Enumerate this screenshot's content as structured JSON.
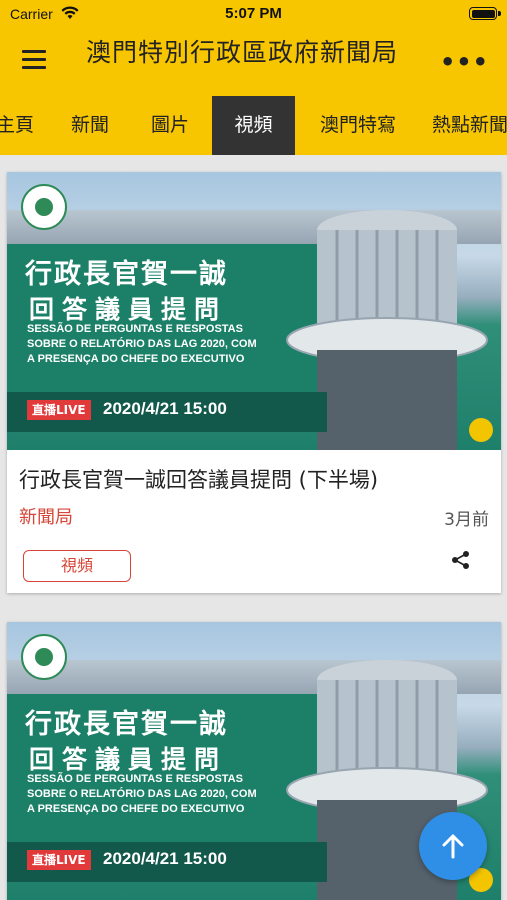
{
  "status_bar": {
    "carrier": "Carrier",
    "time": "5:07 PM"
  },
  "header": {
    "title": "澳門特別行政區政府新聞局"
  },
  "tabs": [
    {
      "label": "主頁"
    },
    {
      "label": "新聞"
    },
    {
      "label": "圖片"
    },
    {
      "label": "視頻",
      "active": true
    },
    {
      "label": "澳門特寫"
    },
    {
      "label": "熱點新聞"
    }
  ],
  "cards": [
    {
      "thumb_title_line1": "行政長官賀一誠",
      "thumb_title_line2": "回答議員提問",
      "thumb_subtitle": "SESSÃO DE PERGUNTAS E RESPOSTAS SOBRE O RELATÓRIO DAS LAG 2020, COM A PRESENÇA DO CHEFE DO EXECUTIVO",
      "live_label": "直播LIVE",
      "thumb_datetime": "2020/4/21  15:00",
      "title": "行政長官賀一誠回答議員提問 (下半場)",
      "source": "新聞局",
      "time_ago": "3月前",
      "tag": "視頻"
    },
    {
      "thumb_title_line1": "行政長官賀一誠",
      "thumb_title_line2": "回答議員提問",
      "thumb_subtitle": "SESSÃO DE PERGUNTAS E RESPOSTAS SOBRE O RELATÓRIO DAS LAG 2020, COM A PRESENÇA DO CHEFE DO EXECUTIVO",
      "live_label": "直播LIVE",
      "thumb_datetime": "2020/4/21  15:00"
    }
  ],
  "colors": {
    "brand_yellow": "#f7c600",
    "active_tab": "#333333",
    "accent_red": "#d64637",
    "fab_blue": "#2f8fe6"
  },
  "icons": [
    "wifi-icon",
    "battery-icon",
    "menu-icon",
    "more-icon",
    "share-icon",
    "arrow-up-icon",
    "sound-icon"
  ]
}
